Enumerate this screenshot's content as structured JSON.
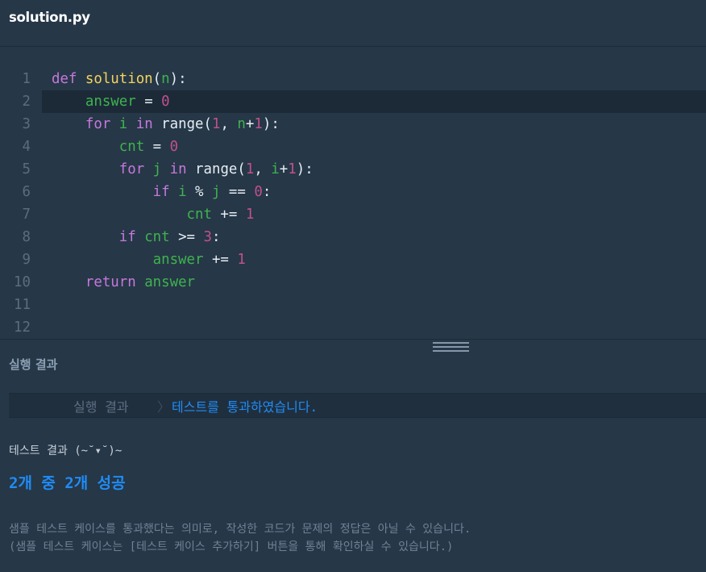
{
  "tab": {
    "title": "solution.py"
  },
  "editor": {
    "active_line": 2,
    "lines": [
      {
        "n": "1",
        "tokens": [
          [
            "kw",
            "def "
          ],
          [
            "fn",
            "solution"
          ],
          [
            "plain",
            "("
          ],
          [
            "var",
            "n"
          ],
          [
            "plain",
            "):"
          ]
        ]
      },
      {
        "n": "2",
        "tokens": [
          [
            "plain",
            "    "
          ],
          [
            "var",
            "answer"
          ],
          [
            "plain",
            " = "
          ],
          [
            "num",
            "0"
          ]
        ]
      },
      {
        "n": "3",
        "tokens": [
          [
            "plain",
            "    "
          ],
          [
            "kw",
            "for "
          ],
          [
            "var",
            "i "
          ],
          [
            "kw",
            "in "
          ],
          [
            "plain",
            "range("
          ],
          [
            "num",
            "1"
          ],
          [
            "plain",
            ", "
          ],
          [
            "var",
            "n"
          ],
          [
            "plain",
            "+"
          ],
          [
            "num",
            "1"
          ],
          [
            "plain",
            "):"
          ]
        ]
      },
      {
        "n": "4",
        "tokens": [
          [
            "plain",
            "        "
          ],
          [
            "var",
            "cnt"
          ],
          [
            "plain",
            " = "
          ],
          [
            "num",
            "0"
          ]
        ]
      },
      {
        "n": "5",
        "tokens": [
          [
            "plain",
            "        "
          ],
          [
            "kw",
            "for "
          ],
          [
            "var",
            "j "
          ],
          [
            "kw",
            "in "
          ],
          [
            "plain",
            "range("
          ],
          [
            "num",
            "1"
          ],
          [
            "plain",
            ", "
          ],
          [
            "var",
            "i"
          ],
          [
            "plain",
            "+"
          ],
          [
            "num",
            "1"
          ],
          [
            "plain",
            "):"
          ]
        ]
      },
      {
        "n": "6",
        "tokens": [
          [
            "plain",
            "            "
          ],
          [
            "kw",
            "if "
          ],
          [
            "var",
            "i"
          ],
          [
            "plain",
            " % "
          ],
          [
            "var",
            "j"
          ],
          [
            "plain",
            " == "
          ],
          [
            "num",
            "0"
          ],
          [
            "plain",
            ":"
          ]
        ]
      },
      {
        "n": "7",
        "tokens": [
          [
            "plain",
            "                "
          ],
          [
            "var",
            "cnt"
          ],
          [
            "plain",
            " += "
          ],
          [
            "num",
            "1"
          ]
        ]
      },
      {
        "n": "8",
        "tokens": [
          [
            "plain",
            "        "
          ],
          [
            "kw",
            "if "
          ],
          [
            "var",
            "cnt"
          ],
          [
            "plain",
            " >= "
          ],
          [
            "num",
            "3"
          ],
          [
            "plain",
            ":"
          ]
        ]
      },
      {
        "n": "9",
        "tokens": [
          [
            "plain",
            "            "
          ],
          [
            "var",
            "answer"
          ],
          [
            "plain",
            " += "
          ],
          [
            "num",
            "1"
          ]
        ]
      },
      {
        "n": "10",
        "tokens": [
          [
            "plain",
            "    "
          ],
          [
            "kw",
            "return "
          ],
          [
            "var",
            "answer"
          ]
        ]
      },
      {
        "n": "11",
        "tokens": []
      },
      {
        "n": "12",
        "tokens": []
      }
    ]
  },
  "output": {
    "section_title": "실행 결과",
    "breadcrumb_label": "실행 결과",
    "breadcrumb_sep": "〉",
    "status": "테스트를 통과하였습니다.",
    "result_header": "테스트 결과 (~˘▾˘)~",
    "score": "2개 중 2개 성공",
    "note_line1": "샘플 테스트 케이스를 통과했다는 의미로, 작성한 코드가 문제의 정답은 아닐 수 있습니다.",
    "note_line2": "(샘플 테스트 케이스는 [테스트 케이스 추가하기] 버튼을 통해 확인하실 수 있습니다.)"
  }
}
